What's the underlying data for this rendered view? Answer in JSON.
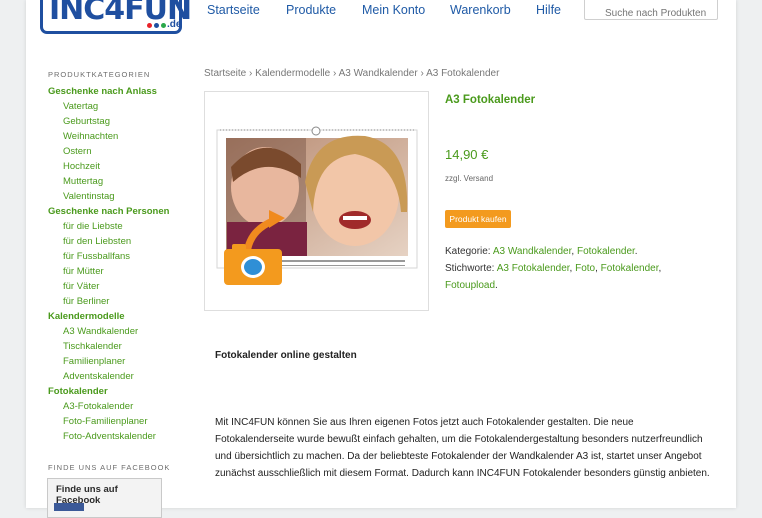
{
  "header": {
    "logo": {
      "text": "INC4FUN",
      "suffix": ".de",
      "dot_colors": [
        "#e8232a",
        "#1f4fa0",
        "#2aa84a"
      ]
    },
    "nav": [
      "Startseite",
      "Produkte",
      "Mein Konto",
      "Warenkorb",
      "Hilfe"
    ],
    "search_placeholder": "Suche nach Produkten"
  },
  "sidebar": {
    "categories_heading": "PRODUKTKATEGORIEN",
    "categories": [
      {
        "label": "Geschenke nach Anlass",
        "items": [
          "Vatertag",
          "Geburtstag",
          "Weihnachten",
          "Ostern",
          "Hochzeit",
          "Muttertag",
          "Valentinstag"
        ]
      },
      {
        "label": "Geschenke nach Personen",
        "items": [
          "für die Liebste",
          "für den Liebsten",
          "für Fussballfans",
          "für Mütter",
          "für Väter",
          "für Berliner"
        ]
      },
      {
        "label": "Kalendermodelle",
        "items": [
          "A3 Wandkalender",
          "Tischkalender",
          "Familienplaner",
          "Adventskalender"
        ]
      },
      {
        "label": "Fotokalender",
        "items": [
          "A3-Fotokalender",
          "Foto-Familienplaner",
          "Foto-Adventskalender"
        ]
      }
    ],
    "facebook_heading": "FINDE UNS AUF FACEBOOK",
    "facebook_box_title": "Finde uns auf Facebook"
  },
  "breadcrumb": [
    "Startseite",
    "Kalendermodelle",
    "A3 Wandkalender",
    "A3 Fotokalender"
  ],
  "breadcrumb_separator": "›",
  "product": {
    "title": "A3 Fotokalender",
    "price": "14,90 €",
    "shipping": "zzgl. Versand",
    "buy_button": "Produkt kaufen",
    "category_label": "Kategorie:",
    "categories": [
      "A3 Wandkalender",
      "Fotokalender"
    ],
    "tags_label": "Stichworte:",
    "tags": [
      "A3 Fotokalender",
      "Foto",
      "Fotokalender",
      "Fotoupload"
    ]
  },
  "description": {
    "heading": "Fotokalender online gestalten",
    "text": "Mit INC4FUN können Sie aus Ihren eigenen Fotos jetzt auch Fotokalender gestalten. Die neue Fotokalenderseite wurde bewußt einfach gehalten, um die Fotokalendergestaltung besonders nutzerfreundlich und übersichtlich zu machen. Da der beliebteste Fotokalender der Wandkalender A3 ist, startet unser Angebot zunächst ausschließlich mit diesem Format. Dadurch kann INC4FUN Fotokalender besonders günstig anbieten."
  },
  "colors": {
    "nav_blue": "#1f5aa6",
    "link_green": "#4a9a1c",
    "button_orange": "#f39a1e"
  }
}
